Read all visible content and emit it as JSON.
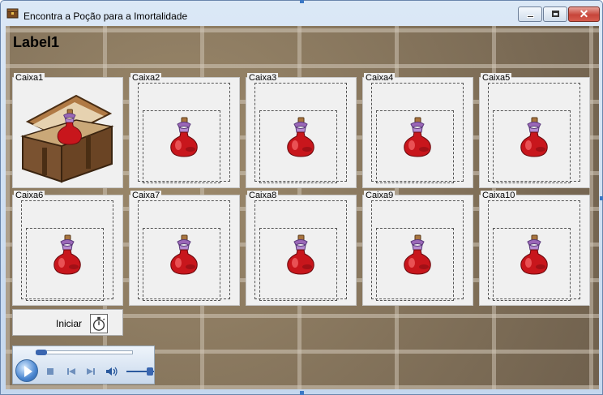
{
  "window": {
    "title": "Encontra a Poção para a Imortalidade",
    "close_glyph": "✕"
  },
  "form": {
    "label1": "Label1"
  },
  "boxes": [
    {
      "label": "Caixa1",
      "content": "treasure-chest-with-potion"
    },
    {
      "label": "Caixa2",
      "content": "potion"
    },
    {
      "label": "Caixa3",
      "content": "potion"
    },
    {
      "label": "Caixa4",
      "content": "potion"
    },
    {
      "label": "Caixa5",
      "content": "potion"
    },
    {
      "label": "Caixa6",
      "content": "potion"
    },
    {
      "label": "Caixa7",
      "content": "potion"
    },
    {
      "label": "Caixa8",
      "content": "potion"
    },
    {
      "label": "Caixa9",
      "content": "potion"
    },
    {
      "label": "Caixa10",
      "content": "potion"
    }
  ],
  "start_button": {
    "label": "Iniciar",
    "icon": "stopwatch-icon"
  },
  "media_player": {
    "seek_position": 0,
    "volume": 0.75,
    "controls": [
      "play",
      "stop",
      "previous",
      "next",
      "mute",
      "volume"
    ]
  },
  "colors": {
    "potion_red": "#c8161c",
    "potion_cap": "#9a67b8",
    "cork": "#a8743f"
  }
}
